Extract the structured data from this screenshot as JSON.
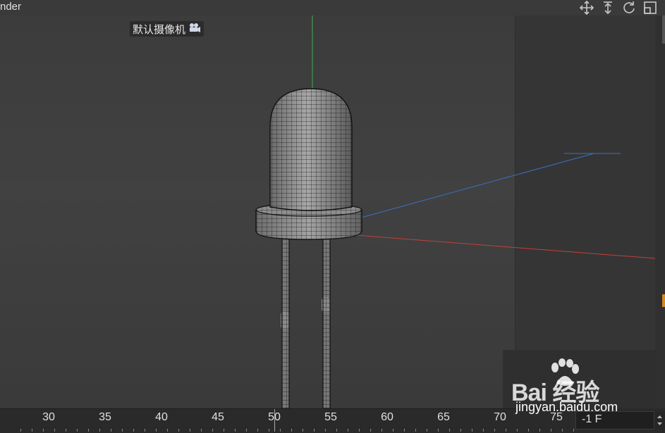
{
  "window": {
    "title": "nder"
  },
  "nav_icons": [
    "move-view-icon",
    "dolly-view-icon",
    "rotate-view-icon",
    "maximize-view-icon"
  ],
  "viewport": {
    "camera_label": "默认摄像机",
    "camera_icon": "camera-icon",
    "axis_colors": {
      "y": "#3fae5a",
      "z": "#3a6fc4",
      "x": "#c4403a"
    }
  },
  "timeline": {
    "ticks": [
      "30",
      "35",
      "40",
      "45",
      "50",
      "55",
      "60",
      "65",
      "70",
      "75"
    ],
    "current_frame": "50"
  },
  "frame_field": {
    "value": "-1 F"
  },
  "watermark": {
    "brand": "Bai 经验",
    "url": "jingyan.baidu.com"
  }
}
